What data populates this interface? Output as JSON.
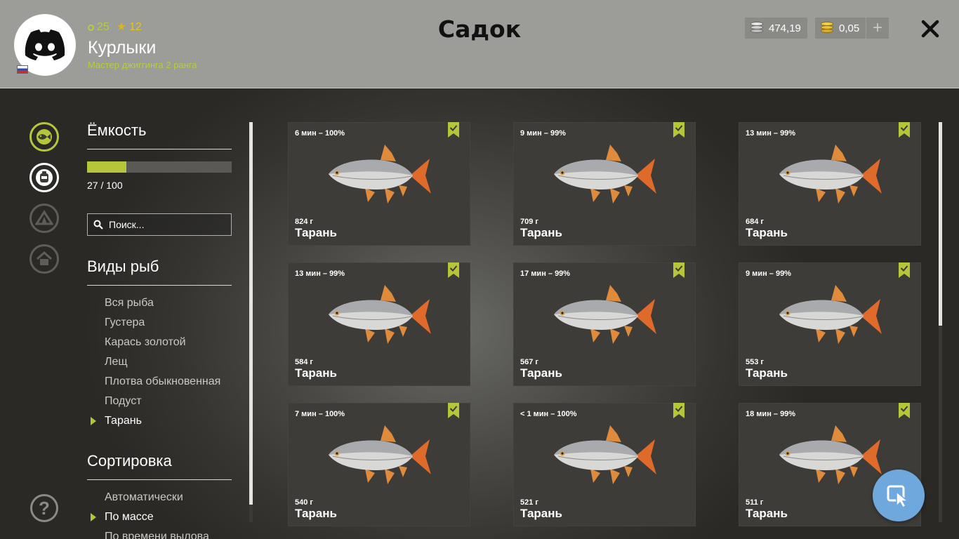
{
  "header": {
    "title": "Садок",
    "player": {
      "level": "25",
      "stars": "12",
      "name": "Курлыки",
      "rank": "Мастер джиггинга 2 ранга"
    },
    "silver": "474,19",
    "gold": "0,05",
    "plus_label": "+",
    "icons": [
      "discord-logo-icon",
      "russia-flag-icon",
      "silver-coins-icon",
      "gold-coins-icon",
      "close-icon"
    ]
  },
  "nav": {
    "icons": [
      "fish-icon",
      "backpack-icon",
      "tent-icon",
      "house-icon",
      "help-icon"
    ],
    "active": "fish-icon",
    "help_label": "?"
  },
  "capacity": {
    "title": "Ёмкость",
    "current": 27,
    "max": 100,
    "label": "27 / 100"
  },
  "search": {
    "placeholder": "Поиск..."
  },
  "species": {
    "title": "Виды рыб",
    "items": [
      {
        "label": "Вся рыба",
        "active": false
      },
      {
        "label": "Густера",
        "active": false
      },
      {
        "label": "Карась золотой",
        "active": false
      },
      {
        "label": "Лещ",
        "active": false
      },
      {
        "label": "Плотва обыкновенная",
        "active": false
      },
      {
        "label": "Подуст",
        "active": false
      },
      {
        "label": "Тарань",
        "active": true
      }
    ]
  },
  "sorting": {
    "title": "Сортировка",
    "items": [
      {
        "label": "Автоматически",
        "active": false
      },
      {
        "label": "По массе",
        "active": true
      },
      {
        "label": "По времени вылова",
        "active": false
      }
    ]
  },
  "fish": [
    {
      "time": "6 мин – 100%",
      "weight": "824 г",
      "name": "Тарань"
    },
    {
      "time": "9 мин – 99%",
      "weight": "709 г",
      "name": "Тарань"
    },
    {
      "time": "13 мин – 99%",
      "weight": "684 г",
      "name": "Тарань"
    },
    {
      "time": "13 мин – 99%",
      "weight": "584 г",
      "name": "Тарань"
    },
    {
      "time": "17 мин – 99%",
      "weight": "567 г",
      "name": "Тарань"
    },
    {
      "time": "9 мин – 99%",
      "weight": "553 г",
      "name": "Тарань"
    },
    {
      "time": "7 мин – 100%",
      "weight": "540 г",
      "name": "Тарань"
    },
    {
      "time": "< 1 мин – 100%",
      "weight": "521 г",
      "name": "Тарань"
    },
    {
      "time": "18 мин – 99%",
      "weight": "511 г",
      "name": "Тарань"
    }
  ],
  "colors": {
    "accent": "#b5c63a",
    "header_bg": "#9c9c98",
    "card_bg": "#3d3c39",
    "fab": "#6fa8dc"
  },
  "fab_icon": "cursor-pointer-icon"
}
